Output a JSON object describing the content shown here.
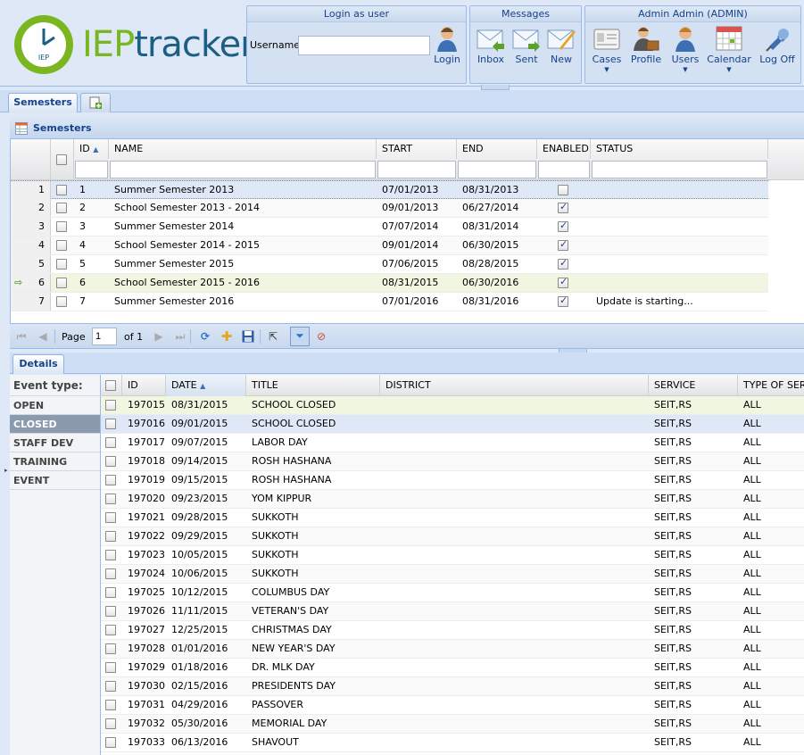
{
  "header": {
    "logo": {
      "part1": "IEP",
      "part2": "tracker",
      "badge": "IEP"
    },
    "login": {
      "title": "Login as user",
      "username_label": "Username:",
      "username_value": "",
      "login_label": "Login"
    },
    "messages": {
      "title": "Messages",
      "inbox": "Inbox",
      "sent": "Sent",
      "new": "New"
    },
    "admin": {
      "title": "Admin Admin (ADMIN)",
      "cases": "Cases",
      "profile": "Profile",
      "users": "Users",
      "calendar": "Calendar",
      "logoff": "Log Off"
    }
  },
  "top_tabs": [
    {
      "label": "Semesters"
    },
    {
      "label": ""
    }
  ],
  "semesters": {
    "panel_title": "Semesters",
    "columns": [
      "ID",
      "NAME",
      "START",
      "END",
      "ENABLED",
      "STATUS"
    ],
    "rows": [
      {
        "n": "1",
        "id": "1",
        "name": "Summer Semester 2013",
        "start": "07/01/2013",
        "end": "08/31/2013",
        "enabled": false,
        "status": ""
      },
      {
        "n": "2",
        "id": "2",
        "name": "School Semester 2013 - 2014",
        "start": "09/01/2013",
        "end": "06/27/2014",
        "enabled": true,
        "status": ""
      },
      {
        "n": "3",
        "id": "3",
        "name": "Summer Semester 2014",
        "start": "07/07/2014",
        "end": "08/31/2014",
        "enabled": true,
        "status": ""
      },
      {
        "n": "4",
        "id": "4",
        "name": "School Semester 2014 - 2015",
        "start": "09/01/2014",
        "end": "06/30/2015",
        "enabled": true,
        "status": ""
      },
      {
        "n": "5",
        "id": "5",
        "name": "Summer Semester 2015",
        "start": "07/06/2015",
        "end": "08/28/2015",
        "enabled": true,
        "status": ""
      },
      {
        "n": "6",
        "id": "6",
        "name": "School Semester 2015 - 2016",
        "start": "08/31/2015",
        "end": "06/30/2016",
        "enabled": true,
        "status": ""
      },
      {
        "n": "7",
        "id": "7",
        "name": "Summer Semester 2016",
        "start": "07/01/2016",
        "end": "08/31/2016",
        "enabled": true,
        "status": "Update is starting..."
      }
    ],
    "paging": {
      "page_label": "Page",
      "page_value": "1",
      "of_label": "of 1"
    }
  },
  "details": {
    "tab_label": "Details",
    "event_type_label": "Event type:",
    "event_types": [
      "OPEN",
      "CLOSED",
      "STAFF DEV",
      "TRAINING",
      "EVENT"
    ],
    "selected_event_type": "CLOSED",
    "columns": [
      "ID",
      "DATE",
      "TITLE",
      "DISTRICT",
      "SERVICE",
      "TYPE OF SERV"
    ],
    "rows": [
      {
        "id": "197015",
        "date": "08/31/2015",
        "title": "SCHOOL CLOSED",
        "district": "",
        "service": "SEIT,RS",
        "type": "ALL"
      },
      {
        "id": "197016",
        "date": "09/01/2015",
        "title": "SCHOOL CLOSED",
        "district": "",
        "service": "SEIT,RS",
        "type": "ALL"
      },
      {
        "id": "197017",
        "date": "09/07/2015",
        "title": "LABOR DAY",
        "district": "",
        "service": "SEIT,RS",
        "type": "ALL"
      },
      {
        "id": "197018",
        "date": "09/14/2015",
        "title": "ROSH HASHANA",
        "district": "",
        "service": "SEIT,RS",
        "type": "ALL"
      },
      {
        "id": "197019",
        "date": "09/15/2015",
        "title": "ROSH HASHANA",
        "district": "",
        "service": "SEIT,RS",
        "type": "ALL"
      },
      {
        "id": "197020",
        "date": "09/23/2015",
        "title": "YOM KIPPUR",
        "district": "",
        "service": "SEIT,RS",
        "type": "ALL"
      },
      {
        "id": "197021",
        "date": "09/28/2015",
        "title": "SUKKOTH",
        "district": "",
        "service": "SEIT,RS",
        "type": "ALL"
      },
      {
        "id": "197022",
        "date": "09/29/2015",
        "title": "SUKKOTH",
        "district": "",
        "service": "SEIT,RS",
        "type": "ALL"
      },
      {
        "id": "197023",
        "date": "10/05/2015",
        "title": "SUKKOTH",
        "district": "",
        "service": "SEIT,RS",
        "type": "ALL"
      },
      {
        "id": "197024",
        "date": "10/06/2015",
        "title": "SUKKOTH",
        "district": "",
        "service": "SEIT,RS",
        "type": "ALL"
      },
      {
        "id": "197025",
        "date": "10/12/2015",
        "title": "COLUMBUS DAY",
        "district": "",
        "service": "SEIT,RS",
        "type": "ALL"
      },
      {
        "id": "197026",
        "date": "11/11/2015",
        "title": "VETERAN'S DAY",
        "district": "",
        "service": "SEIT,RS",
        "type": "ALL"
      },
      {
        "id": "197027",
        "date": "12/25/2015",
        "title": "CHRISTMAS DAY",
        "district": "",
        "service": "SEIT,RS",
        "type": "ALL"
      },
      {
        "id": "197028",
        "date": "01/01/2016",
        "title": "NEW YEAR'S DAY",
        "district": "",
        "service": "SEIT,RS",
        "type": "ALL"
      },
      {
        "id": "197029",
        "date": "01/18/2016",
        "title": "DR. MLK DAY",
        "district": "",
        "service": "SEIT,RS",
        "type": "ALL"
      },
      {
        "id": "197030",
        "date": "02/15/2016",
        "title": "PRESIDENTS DAY",
        "district": "",
        "service": "SEIT,RS",
        "type": "ALL"
      },
      {
        "id": "197031",
        "date": "04/29/2016",
        "title": "PASSOVER",
        "district": "",
        "service": "SEIT,RS",
        "type": "ALL"
      },
      {
        "id": "197032",
        "date": "05/30/2016",
        "title": "MEMORIAL DAY",
        "district": "",
        "service": "SEIT,RS",
        "type": "ALL"
      },
      {
        "id": "197033",
        "date": "06/13/2016",
        "title": "SHAVOUT",
        "district": "",
        "service": "SEIT,RS",
        "type": "ALL"
      }
    ]
  },
  "colors": {
    "accent": "#15428b",
    "brand_green": "#7ab61f",
    "brand_blue": "#1d5f83",
    "selected_row": "#dfe8f6",
    "current_row": "#f1f6e1"
  }
}
